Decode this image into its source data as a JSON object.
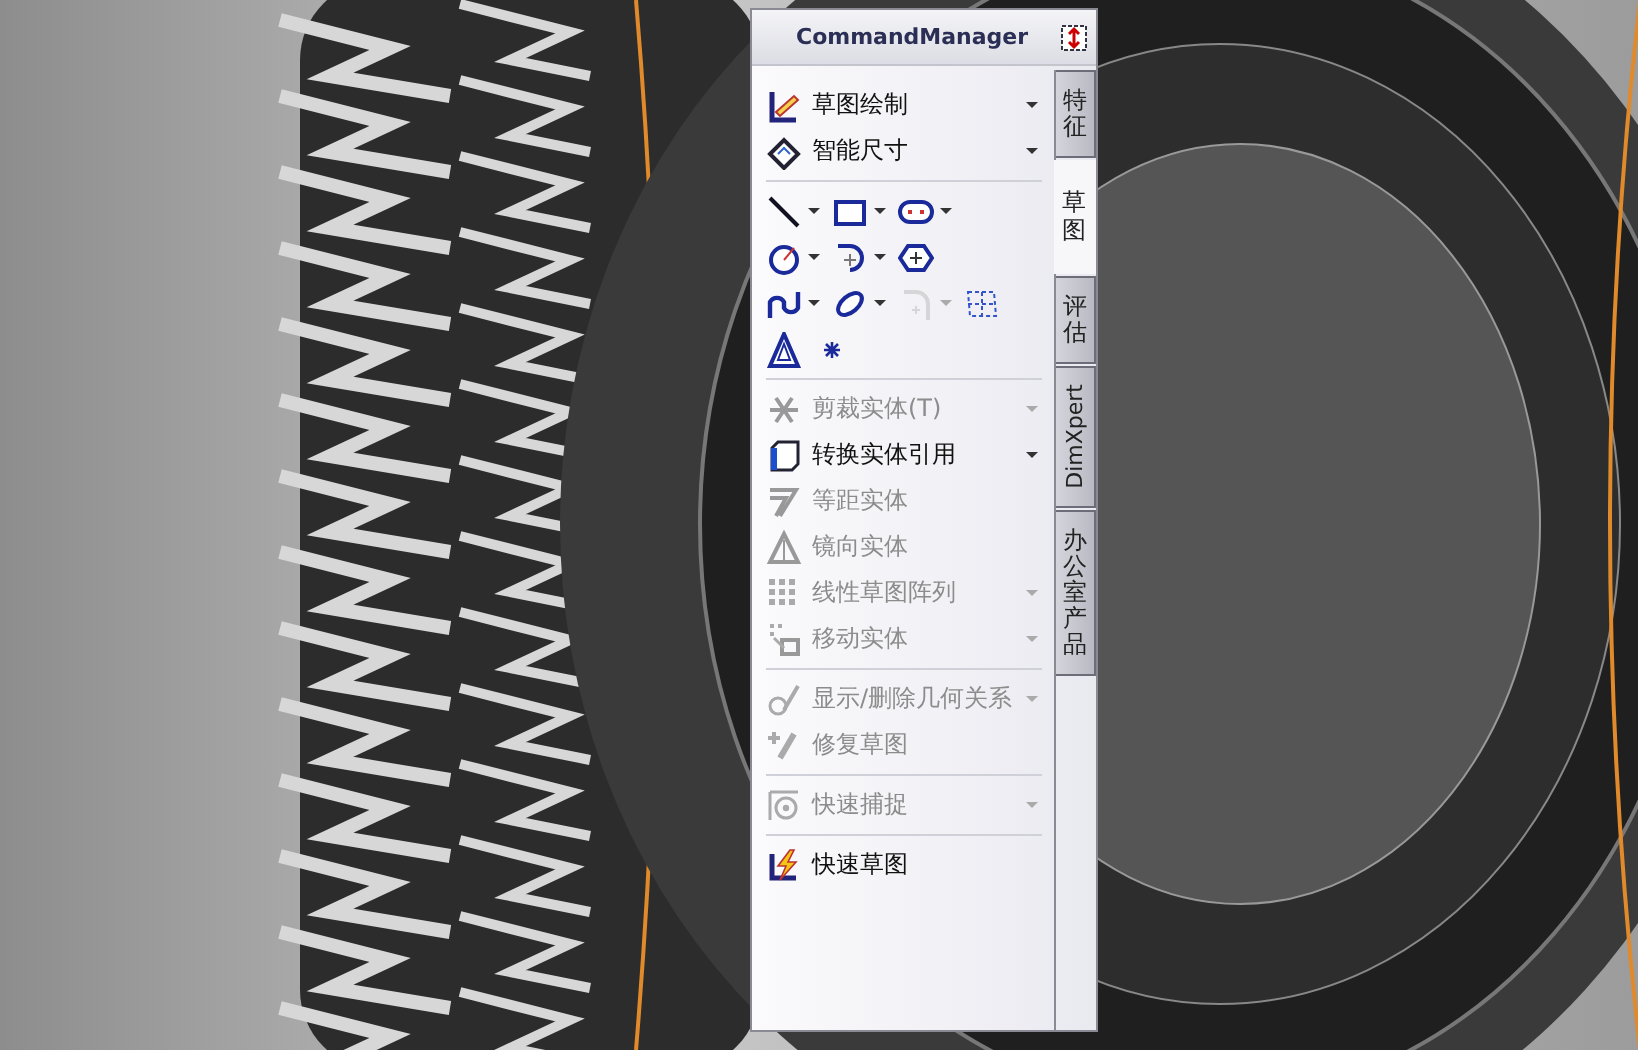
{
  "panel": {
    "title": "CommandManager"
  },
  "sections": [
    {
      "kind": "commands",
      "items": [
        {
          "label": "草图绘制",
          "dropdown": true,
          "disabled": false
        },
        {
          "label": "智能尺寸",
          "dropdown": true,
          "disabled": false
        }
      ]
    },
    {
      "kind": "icons",
      "rows": [
        [
          {
            "dropdown": true,
            "disabled": false
          },
          {
            "dropdown": true,
            "disabled": false
          },
          {
            "dropdown": true,
            "disabled": false
          }
        ],
        [
          {
            "dropdown": true,
            "disabled": false
          },
          {
            "dropdown": true,
            "disabled": false
          },
          {
            "dropdown": false,
            "disabled": false
          }
        ],
        [
          {
            "dropdown": true,
            "disabled": false
          },
          {
            "dropdown": true,
            "disabled": false
          },
          {
            "dropdown": true,
            "disabled": true
          },
          {
            "dropdown": false,
            "disabled": false
          }
        ],
        [
          {
            "dropdown": false,
            "disabled": false
          },
          {
            "dropdown": false,
            "disabled": false
          }
        ]
      ]
    },
    {
      "kind": "commands",
      "items": [
        {
          "label": "剪裁实体(T)",
          "dropdown": true,
          "disabled": true
        },
        {
          "label": "转换实体引用",
          "dropdown": true,
          "disabled": false
        },
        {
          "label": "等距实体",
          "dropdown": false,
          "disabled": true
        },
        {
          "label": "镜向实体",
          "dropdown": false,
          "disabled": true
        },
        {
          "label": "线性草图阵列",
          "dropdown": true,
          "disabled": true
        },
        {
          "label": "移动实体",
          "dropdown": true,
          "disabled": true
        }
      ]
    },
    {
      "kind": "commands",
      "items": [
        {
          "label": "显示/删除几何关系",
          "dropdown": true,
          "disabled": true
        },
        {
          "label": "修复草图",
          "dropdown": false,
          "disabled": true
        }
      ]
    },
    {
      "kind": "commands",
      "items": [
        {
          "label": "快速捕捉",
          "dropdown": true,
          "disabled": true
        }
      ]
    },
    {
      "kind": "commands",
      "items": [
        {
          "label": "快速草图",
          "dropdown": false,
          "disabled": false
        }
      ]
    }
  ],
  "tabs": [
    {
      "label": "特征",
      "selected": false
    },
    {
      "label": "草图",
      "selected": true
    },
    {
      "label": "评估",
      "selected": false
    },
    {
      "label": "DimXpert",
      "selected": false,
      "kind": "latin"
    },
    {
      "label": "办公室产品",
      "selected": false
    }
  ]
}
